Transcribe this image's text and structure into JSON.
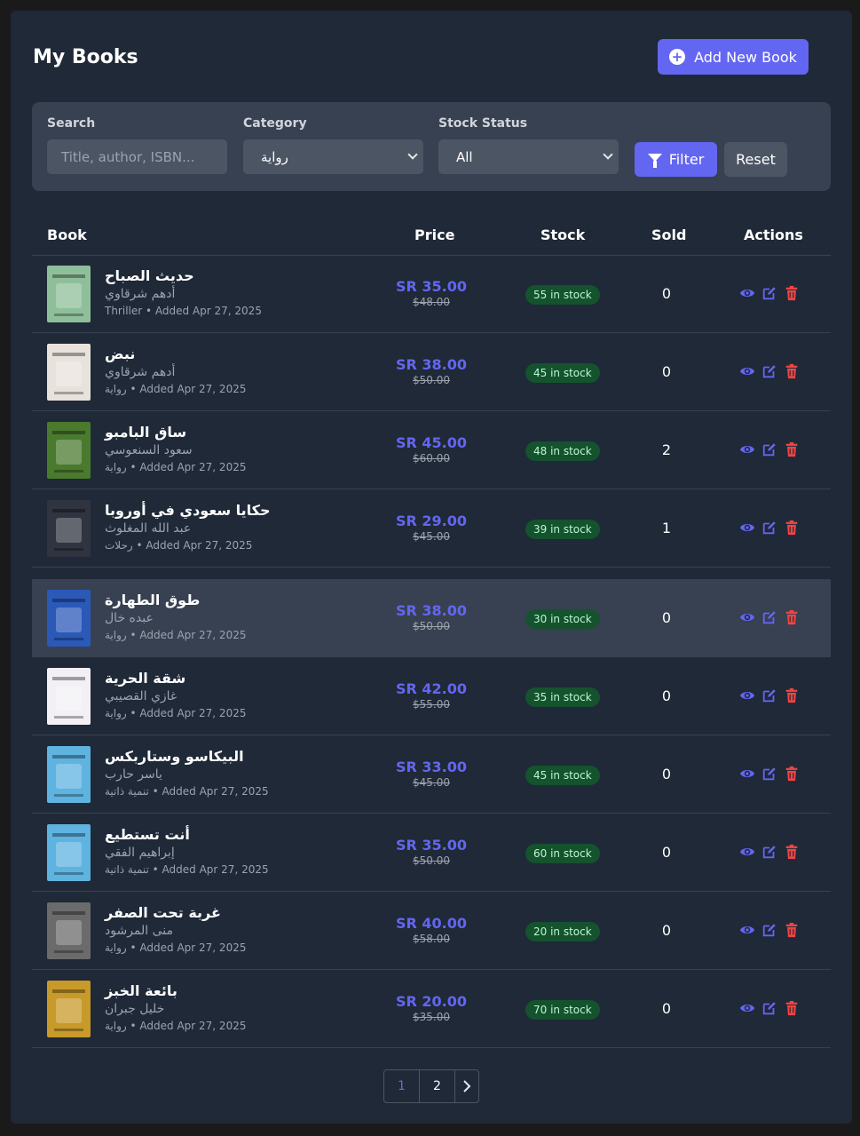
{
  "header": {
    "title": "My Books",
    "add_label": "Add New Book"
  },
  "filters": {
    "search_label": "Search",
    "search_placeholder": "Title, author, ISBN...",
    "category_label": "Category",
    "category_value": "رواية",
    "stock_label": "Stock Status",
    "stock_value": "All",
    "filter_label": "Filter",
    "reset_label": "Reset"
  },
  "table": {
    "headers": {
      "book": "Book",
      "price": "Price",
      "stock": "Stock",
      "sold": "Sold",
      "actions": "Actions"
    },
    "rows": [
      {
        "title": "حديث الصباح",
        "author": "أدهم شرقاوي",
        "meta": "Thriller • Added Apr 27, 2025",
        "price": "SR 35.00",
        "old_price": "$48.00",
        "stock": "55 in stock",
        "sold": "0",
        "cover_color": "#8fbf9a"
      },
      {
        "title": "نبض",
        "author": "أدهم شرقاوي",
        "meta": "رواية • Added Apr 27, 2025",
        "price": "SR 38.00",
        "old_price": "$50.00",
        "stock": "45 in stock",
        "sold": "0",
        "cover_color": "#e8e2dc"
      },
      {
        "title": "ساق البامبو",
        "author": "سعود السنعوسي",
        "meta": "رواية • Added Apr 27, 2025",
        "price": "SR 45.00",
        "old_price": "$60.00",
        "stock": "48 in stock",
        "sold": "2",
        "cover_color": "#4a7a2e"
      },
      {
        "title": "حكايا سعودي في أوروبا",
        "author": "عبد الله المغلوث",
        "meta": "رحلات • Added Apr 27, 2025",
        "price": "SR 29.00",
        "old_price": "$45.00",
        "stock": "39 in stock",
        "sold": "1",
        "cover_color": "#2f3440"
      },
      {
        "title": "طوق الطهارة",
        "author": "عبده خال",
        "meta": "رواية • Added Apr 27, 2025",
        "price": "SR 38.00",
        "old_price": "$50.00",
        "stock": "30 in stock",
        "sold": "0",
        "cover_color": "#2b59b8"
      },
      {
        "title": "شقة الحرية",
        "author": "غازي القصيبي",
        "meta": "رواية • Added Apr 27, 2025",
        "price": "SR 42.00",
        "old_price": "$55.00",
        "stock": "35 in stock",
        "sold": "0",
        "cover_color": "#f2f0f5"
      },
      {
        "title": "البيكاسو وستاربكس",
        "author": "ياسر حارب",
        "meta": "تنمية ذاتية • Added Apr 27, 2025",
        "price": "SR 33.00",
        "old_price": "$45.00",
        "stock": "45 in stock",
        "sold": "0",
        "cover_color": "#5fb3e0"
      },
      {
        "title": "أنت تستطيع",
        "author": "إبراهيم الفقي",
        "meta": "تنمية ذاتية • Added Apr 27, 2025",
        "price": "SR 35.00",
        "old_price": "$50.00",
        "stock": "60 in stock",
        "sold": "0",
        "cover_color": "#5fb3e0"
      },
      {
        "title": "غربة تحت الصفر",
        "author": "منى المرشود",
        "meta": "رواية • Added Apr 27, 2025",
        "price": "SR 40.00",
        "old_price": "$58.00",
        "stock": "20 in stock",
        "sold": "0",
        "cover_color": "#6b6b6b"
      },
      {
        "title": "بائعة الخبز",
        "author": "خليل جبران",
        "meta": "رواية • Added Apr 27, 2025",
        "price": "SR 20.00",
        "old_price": "$35.00",
        "stock": "70 in stock",
        "sold": "0",
        "cover_color": "#c89a2a"
      }
    ]
  },
  "pagination": {
    "pages": [
      "1",
      "2"
    ],
    "active": "1"
  },
  "icons": {
    "view": "eye-icon",
    "edit": "edit-icon",
    "delete": "trash-icon"
  },
  "colors": {
    "accent": "#6366f1",
    "danger": "#ef4444",
    "stock_badge": "#14532d"
  }
}
